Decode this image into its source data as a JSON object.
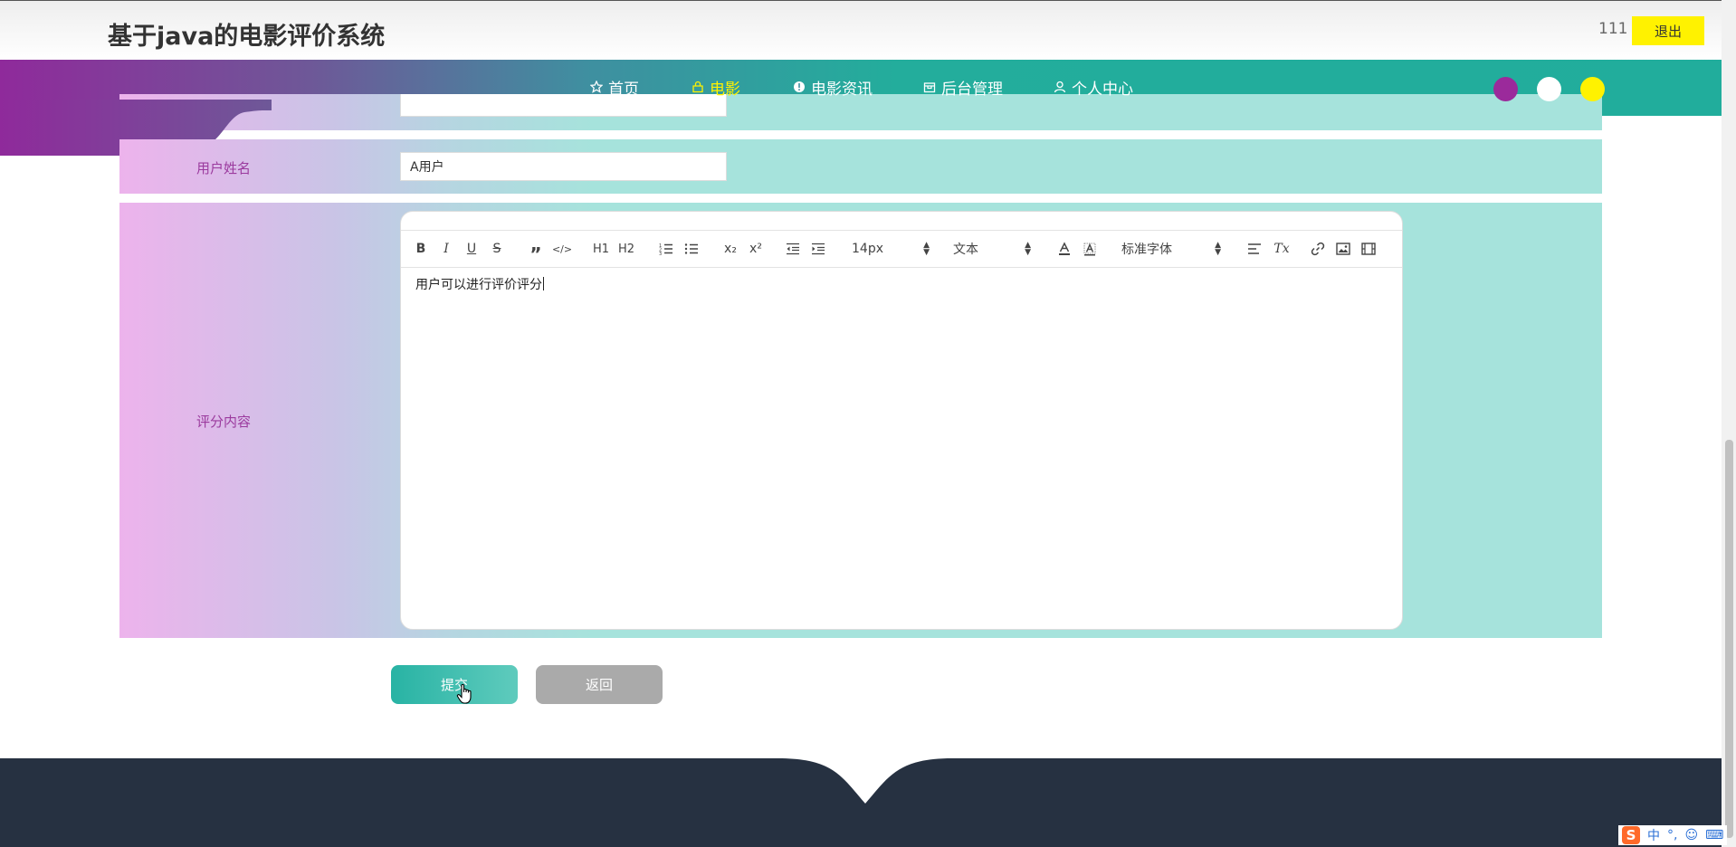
{
  "header": {
    "site_title": "基于java的电影评价系统",
    "username": "111",
    "logout_label": "退出"
  },
  "nav": {
    "items": [
      {
        "label": "首页",
        "icon": "star-icon",
        "active": false
      },
      {
        "label": "电影",
        "icon": "shop-icon",
        "active": true
      },
      {
        "label": "电影资讯",
        "icon": "info-icon",
        "active": false
      },
      {
        "label": "后台管理",
        "icon": "box-icon",
        "active": false
      },
      {
        "label": "个人中心",
        "icon": "user-icon",
        "active": false
      }
    ],
    "theme_colors": [
      "#9b2a9b",
      "#ffffff",
      "#fff200"
    ]
  },
  "form": {
    "user_name": {
      "label": "用户姓名",
      "value": "A用户"
    },
    "review": {
      "label": "评分内容",
      "content": "用户可以进行评价评分"
    },
    "toolbar": {
      "bold": "B",
      "italic": "I",
      "underline": "U",
      "strike": "S",
      "quote": "”",
      "code": "</>",
      "h1": "H1",
      "h2": "H2",
      "sub": "x₂",
      "sup": "x²",
      "size": "14px",
      "header_type": "文本",
      "font": "标准字体",
      "clean": "Tx"
    },
    "submit_label": "提交",
    "back_label": "返回"
  },
  "ime": {
    "logo": "S",
    "lang": "中",
    "punct": "°,",
    "emoji": "☺",
    "keyboard": "⌨"
  },
  "colors": {
    "accent_yellow": "#fff200",
    "nav_teal": "#21ad9c",
    "nav_purple": "#8f2a9b",
    "footer": "#263141",
    "label_purple": "#9b3a9e"
  }
}
